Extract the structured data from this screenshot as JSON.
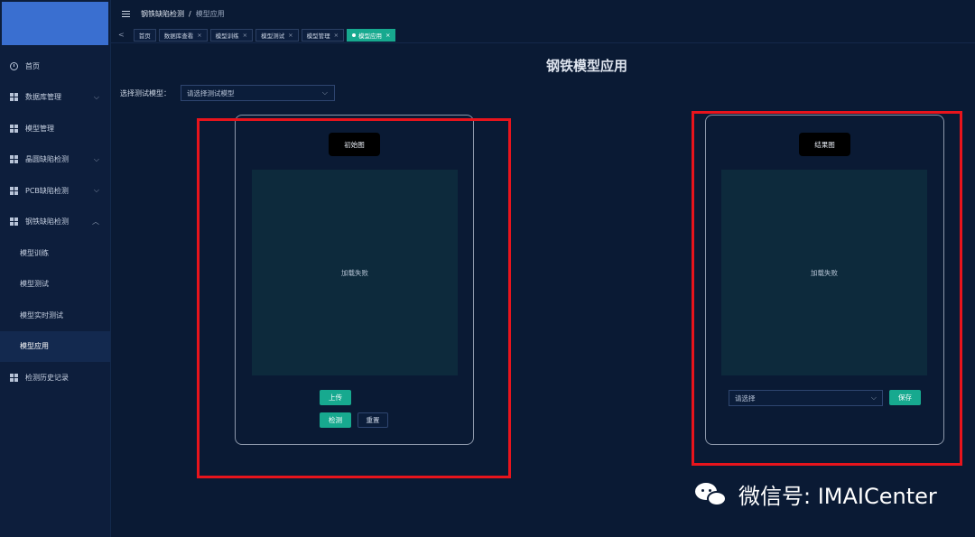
{
  "sidebar": {
    "items": [
      {
        "label": "首页",
        "icon": "clock-icon"
      },
      {
        "label": "数据库管理",
        "icon": "grid-icon",
        "chevron": "⌵"
      },
      {
        "label": "模型管理",
        "icon": "grid-icon"
      },
      {
        "label": "晶圆缺陷检测",
        "icon": "grid-icon",
        "chevron": "⌵"
      },
      {
        "label": "PCB缺陷检测",
        "icon": "grid-icon",
        "chevron": "⌵"
      },
      {
        "label": "钢铁缺陷检测",
        "icon": "grid-icon",
        "chevron": "︿"
      },
      {
        "label": "模型训练",
        "sub": true
      },
      {
        "label": "模型测试",
        "sub": true
      },
      {
        "label": "模型实时测试",
        "sub": true
      },
      {
        "label": "模型应用",
        "sub": true,
        "active": true
      },
      {
        "label": "检测历史记录",
        "icon": "grid-icon"
      }
    ]
  },
  "header": {
    "breadcrumb_parent": "钢铁缺陷检测",
    "breadcrumb_sep": "/",
    "breadcrumb_current": "模型应用"
  },
  "tabs": {
    "back": "<",
    "items": [
      {
        "label": "首页",
        "closable": false
      },
      {
        "label": "数据库查看",
        "closable": true
      },
      {
        "label": "模型训练",
        "closable": true
      },
      {
        "label": "模型测试",
        "closable": true
      },
      {
        "label": "模型管理",
        "closable": true
      },
      {
        "label": "模型应用",
        "closable": true,
        "active": true
      }
    ],
    "close_glyph": "×"
  },
  "main": {
    "title": "钢铁模型应用",
    "select_label": "选择测试模型：",
    "select_value": "请选择测试模型",
    "caret": "⌵"
  },
  "left_card": {
    "title": "初始图",
    "placeholder": "加载失败",
    "upload_label": "上传",
    "detect_label": "检测",
    "reset_label": "重置"
  },
  "right_card": {
    "title": "结果图",
    "placeholder": "加载失败",
    "select_value": "请选择",
    "save_label": "保存"
  },
  "watermark": {
    "text": "微信号: IMAICenter"
  },
  "colors": {
    "accent": "#17a98f",
    "highlight": "#e8141c",
    "background": "#0a1a34"
  }
}
